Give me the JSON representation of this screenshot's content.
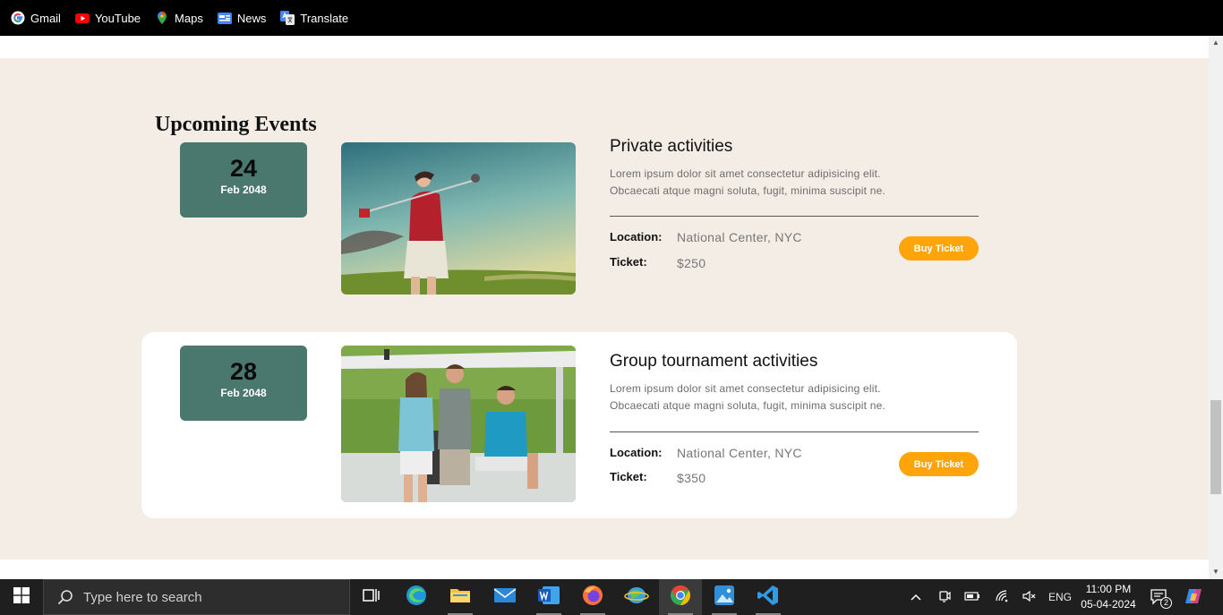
{
  "bookmarks": [
    {
      "label": "Gmail",
      "icon": "google-icon"
    },
    {
      "label": "YouTube",
      "icon": "youtube-icon"
    },
    {
      "label": "Maps",
      "icon": "maps-icon"
    },
    {
      "label": "News",
      "icon": "news-icon"
    },
    {
      "label": "Translate",
      "icon": "translate-icon"
    }
  ],
  "events": {
    "title": "Upcoming Events",
    "items": [
      {
        "day": "24",
        "month": "Feb 2048",
        "title": "Private activities",
        "desc_line1": "Lorem ipsum dolor sit amet consectetur adipisicing elit.",
        "desc_line2": "Obcaecati atque magni soluta, fugit, minima suscipit ne.",
        "location_label": "Location:",
        "location": "National Center, NYC",
        "ticket_label": "Ticket:",
        "price": "$250",
        "button": "Buy Ticket"
      },
      {
        "day": "28",
        "month": "Feb 2048",
        "title": "Group tournament activities",
        "desc_line1": "Lorem ipsum dolor sit amet consectetur adipisicing elit.",
        "desc_line2": "Obcaecati atque magni soluta, fugit, minima suscipit ne.",
        "location_label": "Location:",
        "location": "National Center, NYC",
        "ticket_label": "Ticket:",
        "price": "$350",
        "button": "Buy Ticket"
      }
    ]
  },
  "taskbar": {
    "search_placeholder": "Type here to search",
    "language": "ENG",
    "time": "11:00 PM",
    "date": "05-04-2024",
    "notification_count": "2"
  },
  "colors": {
    "accent": "#ffa50a",
    "date_box": "#4a786e",
    "section_bg": "#f4ede6"
  }
}
